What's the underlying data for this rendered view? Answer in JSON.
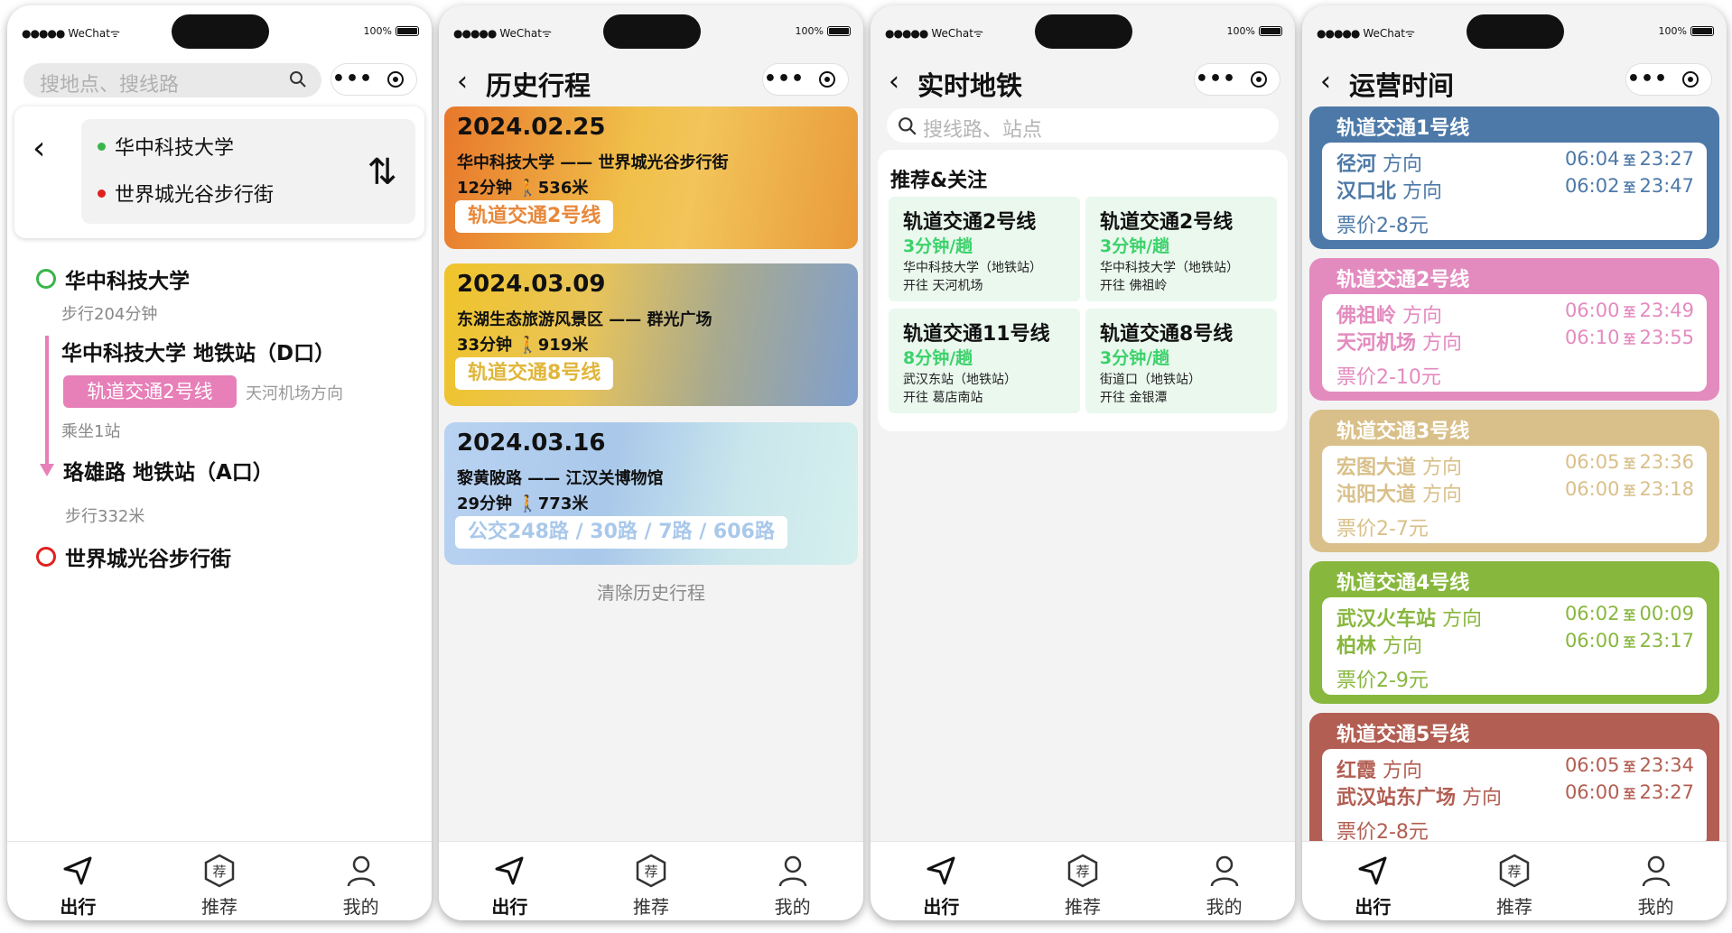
{
  "status_bar": {
    "carrier": "WeChat",
    "battery": "100%"
  },
  "tabbar": {
    "items": [
      "出行",
      "推荐",
      "我的"
    ],
    "rec_icon_char": "荐"
  },
  "phone1": {
    "search_placeholder": "搜地点、搜线路",
    "from": "华中科技大学",
    "to": "世界城光谷步行街",
    "steps": {
      "start": "华中科技大学",
      "walk1": "步行204分钟",
      "station1": "华中科技大学 地铁站（D口）",
      "line": "轨道交通2号线",
      "direction": "天河机场方向",
      "ride": "乘坐1站",
      "station2": "珞雄路 地铁站（A口）",
      "walk2": "步行332米",
      "end": "世界城光谷步行街"
    },
    "colors": {
      "start": "#3ab54a",
      "end": "#e02020",
      "line": "#e77fb8"
    }
  },
  "phone2": {
    "title": "历史行程",
    "cards": [
      {
        "date": "2024.02.25",
        "route": "华中科技大学 —— 世界城光谷步行街",
        "duration": "12分钟",
        "distance": "536米",
        "line": "轨道交通2号线",
        "line_color": "#e8883a"
      },
      {
        "date": "2024.03.09",
        "route": "东湖生态旅游风景区 —— 群光广场",
        "duration": "33分钟",
        "distance": "919米",
        "line": "轨道交通8号线",
        "line_color": "#e0b63a"
      },
      {
        "date": "2024.03.16",
        "route": "黎黄陂路 —— 江汉关博物馆",
        "duration": "29分钟",
        "distance": "773米",
        "line": "公交248路 / 30路 / 7路 / 606路",
        "line_color": "#a9c8ea"
      }
    ],
    "clear": "清除历史行程"
  },
  "phone3": {
    "title": "实时地铁",
    "search_placeholder": "搜线路、站点",
    "section": "推荐&关注",
    "cards": [
      {
        "name": "轨道交通2号线",
        "freq": "3分钟/趟",
        "station": "华中科技大学（地铁站）",
        "dest": "开往 天河机场"
      },
      {
        "name": "轨道交通2号线",
        "freq": "3分钟/趟",
        "station": "华中科技大学（地铁站）",
        "dest": "开往 佛祖岭"
      },
      {
        "name": "轨道交通11号线",
        "freq": "8分钟/趟",
        "station": "武汉东站（地铁站）",
        "dest": "开往 葛店南站"
      },
      {
        "name": "轨道交通8号线",
        "freq": "3分钟/趟",
        "station": "街道口（地铁站）",
        "dest": "开往 金银潭"
      }
    ]
  },
  "phone4": {
    "title": "运营时间",
    "direction_word": "方向",
    "to_word": "至",
    "lines": [
      {
        "name": "轨道交通1号线",
        "color": "#4d79a8",
        "dirs": [
          {
            "station": "径河",
            "start": "06:04",
            "end": "23:27"
          },
          {
            "station": "汉口北",
            "start": "06:02",
            "end": "23:47"
          }
        ],
        "fare": "票价2-8元"
      },
      {
        "name": "轨道交通2号线",
        "color": "#e38bbf",
        "dirs": [
          {
            "station": "佛祖岭",
            "start": "06:00",
            "end": "23:49"
          },
          {
            "station": "天河机场",
            "start": "06:10",
            "end": "23:55"
          }
        ],
        "fare": "票价2-10元"
      },
      {
        "name": "轨道交通3号线",
        "color": "#d9c08a",
        "dirs": [
          {
            "station": "宏图大道",
            "start": "06:05",
            "end": "23:36"
          },
          {
            "station": "沌阳大道",
            "start": "06:00",
            "end": "23:18"
          }
        ],
        "fare": "票价2-7元"
      },
      {
        "name": "轨道交通4号线",
        "color": "#88b73e",
        "dirs": [
          {
            "station": "武汉火车站",
            "start": "06:02",
            "end": "00:09"
          },
          {
            "station": "柏林",
            "start": "06:00",
            "end": "23:17"
          }
        ],
        "fare": "票价2-9元"
      },
      {
        "name": "轨道交通5号线",
        "color": "#b25e52",
        "dirs": [
          {
            "station": "红霞",
            "start": "06:05",
            "end": "23:34"
          },
          {
            "station": "武汉站东广场",
            "start": "06:00",
            "end": "23:27"
          }
        ],
        "fare": "票价2-8元"
      }
    ]
  }
}
